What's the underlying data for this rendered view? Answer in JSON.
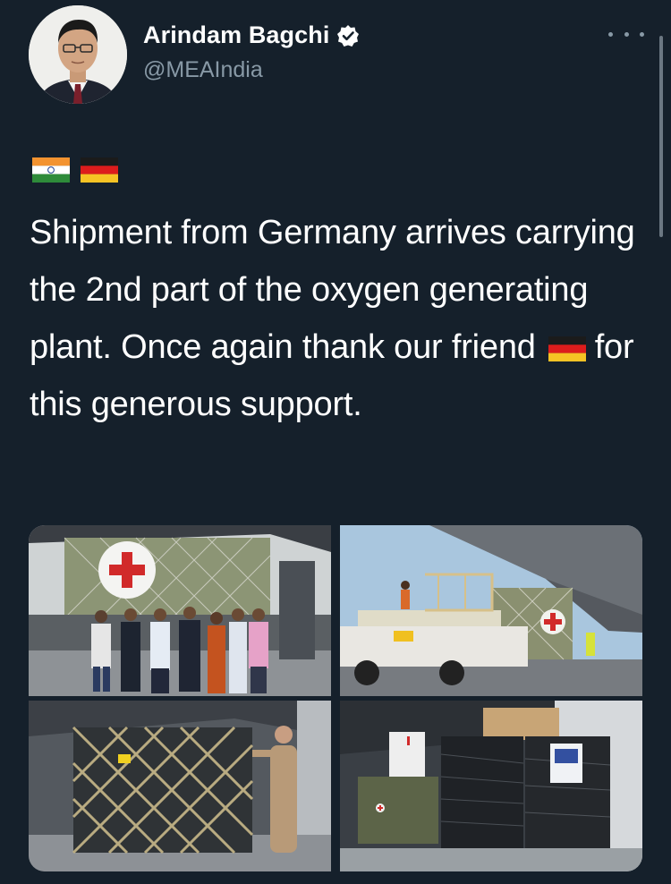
{
  "author": {
    "name": "Arindam Bagchi",
    "handle": "@MEAIndia",
    "verified": true
  },
  "icons": {
    "verified": "verified-badge-icon",
    "more": "more-options-icon",
    "flag_india": "india-flag-icon",
    "flag_germany": "germany-flag-icon"
  },
  "tweet": {
    "line_part1": "Shipment from Germany arrives carrying the 2nd part of the oxygen generating plant. Once again thank our friend",
    "line_part2": "for this generous support."
  },
  "media": {
    "count": 4
  },
  "colors": {
    "background": "#15202b",
    "secondary_text": "#8899a6",
    "verified_badge": "#ffffff"
  }
}
